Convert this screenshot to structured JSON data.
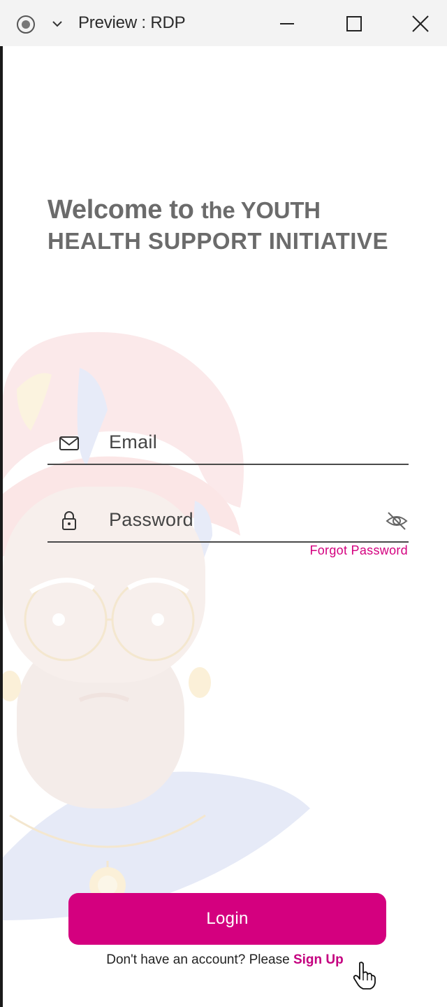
{
  "window": {
    "title": "Preview : RDP",
    "icons": {
      "record": "record-icon",
      "dropdown": "chevron-down-icon",
      "minimize": "minimize-icon",
      "maximize": "maximize-icon",
      "close": "close-icon"
    }
  },
  "welcome": {
    "part1": "Welcome to",
    "part2": "the YOUTH",
    "line2": "HEALTH SUPPORT INITIATIVE"
  },
  "form": {
    "email": {
      "placeholder": "Email",
      "icon": "mail-icon"
    },
    "password": {
      "placeholder": "Password",
      "icon": "lock-icon",
      "toggle_icon": "eye-off-icon"
    },
    "forgot_password": "Forgot Password",
    "login_label": "Login",
    "signup_prompt": "Don't have an account? Please ",
    "signup_link": "Sign Up"
  },
  "colors": {
    "accent": "#d4007f",
    "title_text": "#6b6b6b",
    "titlebar_bg": "#f3f3f3"
  }
}
